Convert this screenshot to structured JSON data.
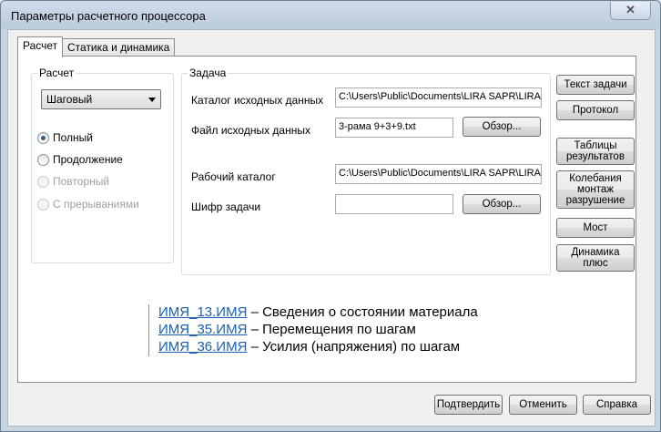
{
  "window": {
    "title": "Параметры расчетного процессора",
    "close_glyph": "✕"
  },
  "tabs": [
    {
      "label": "Расчет"
    },
    {
      "label": "Статика и динамика"
    }
  ],
  "calc_group": {
    "label": "Расчет",
    "mode": "Шаговый",
    "options": [
      {
        "label": "Полный",
        "selected": true,
        "enabled": true
      },
      {
        "label": "Продолжение",
        "selected": false,
        "enabled": true
      },
      {
        "label": "Повторный",
        "selected": false,
        "enabled": false
      },
      {
        "label": "С прерываниями",
        "selected": false,
        "enabled": false
      }
    ]
  },
  "task_group": {
    "label": "Задача",
    "source_dir_label": "Каталог исходных данных",
    "source_dir_value": "C:\\Users\\Public\\Documents\\LIRA SAPR\\LIRA",
    "source_file_label": "Файл исходных данных",
    "source_file_value": "3-рама 9+3+9.txt",
    "browse_label": "Обзор...",
    "work_dir_label": "Рабочий каталог",
    "work_dir_value": "C:\\Users\\Public\\Documents\\LIRA SAPR\\LIRA",
    "cipher_label": "Шифр задачи",
    "cipher_value": ""
  },
  "side_buttons": {
    "task_text": "Текст задачи",
    "protocol": "Протокол",
    "tables_1": "Таблицы",
    "tables_2": "результатов",
    "vib_1": "Колебания",
    "vib_2": "монтаж",
    "vib_3": "разрушение",
    "bridge": "Мост",
    "dyn_1": "Динамика",
    "dyn_2": "плюс"
  },
  "info_links": [
    {
      "link": "ИМЯ_13.ИМЯ",
      "text": " – Сведения о состоянии материала"
    },
    {
      "link": "ИМЯ_35.ИМЯ",
      "text": " – Перемещения по шагам"
    },
    {
      "link": "ИМЯ_36.ИМЯ",
      "text": " – Усилия (напряжения) по шагам"
    }
  ],
  "footer": {
    "confirm": "Подтвердить",
    "cancel": "Отменить",
    "help": "Справка"
  },
  "colors": {
    "link": "#1a5fb4",
    "radio_selected": "#2c628b"
  }
}
